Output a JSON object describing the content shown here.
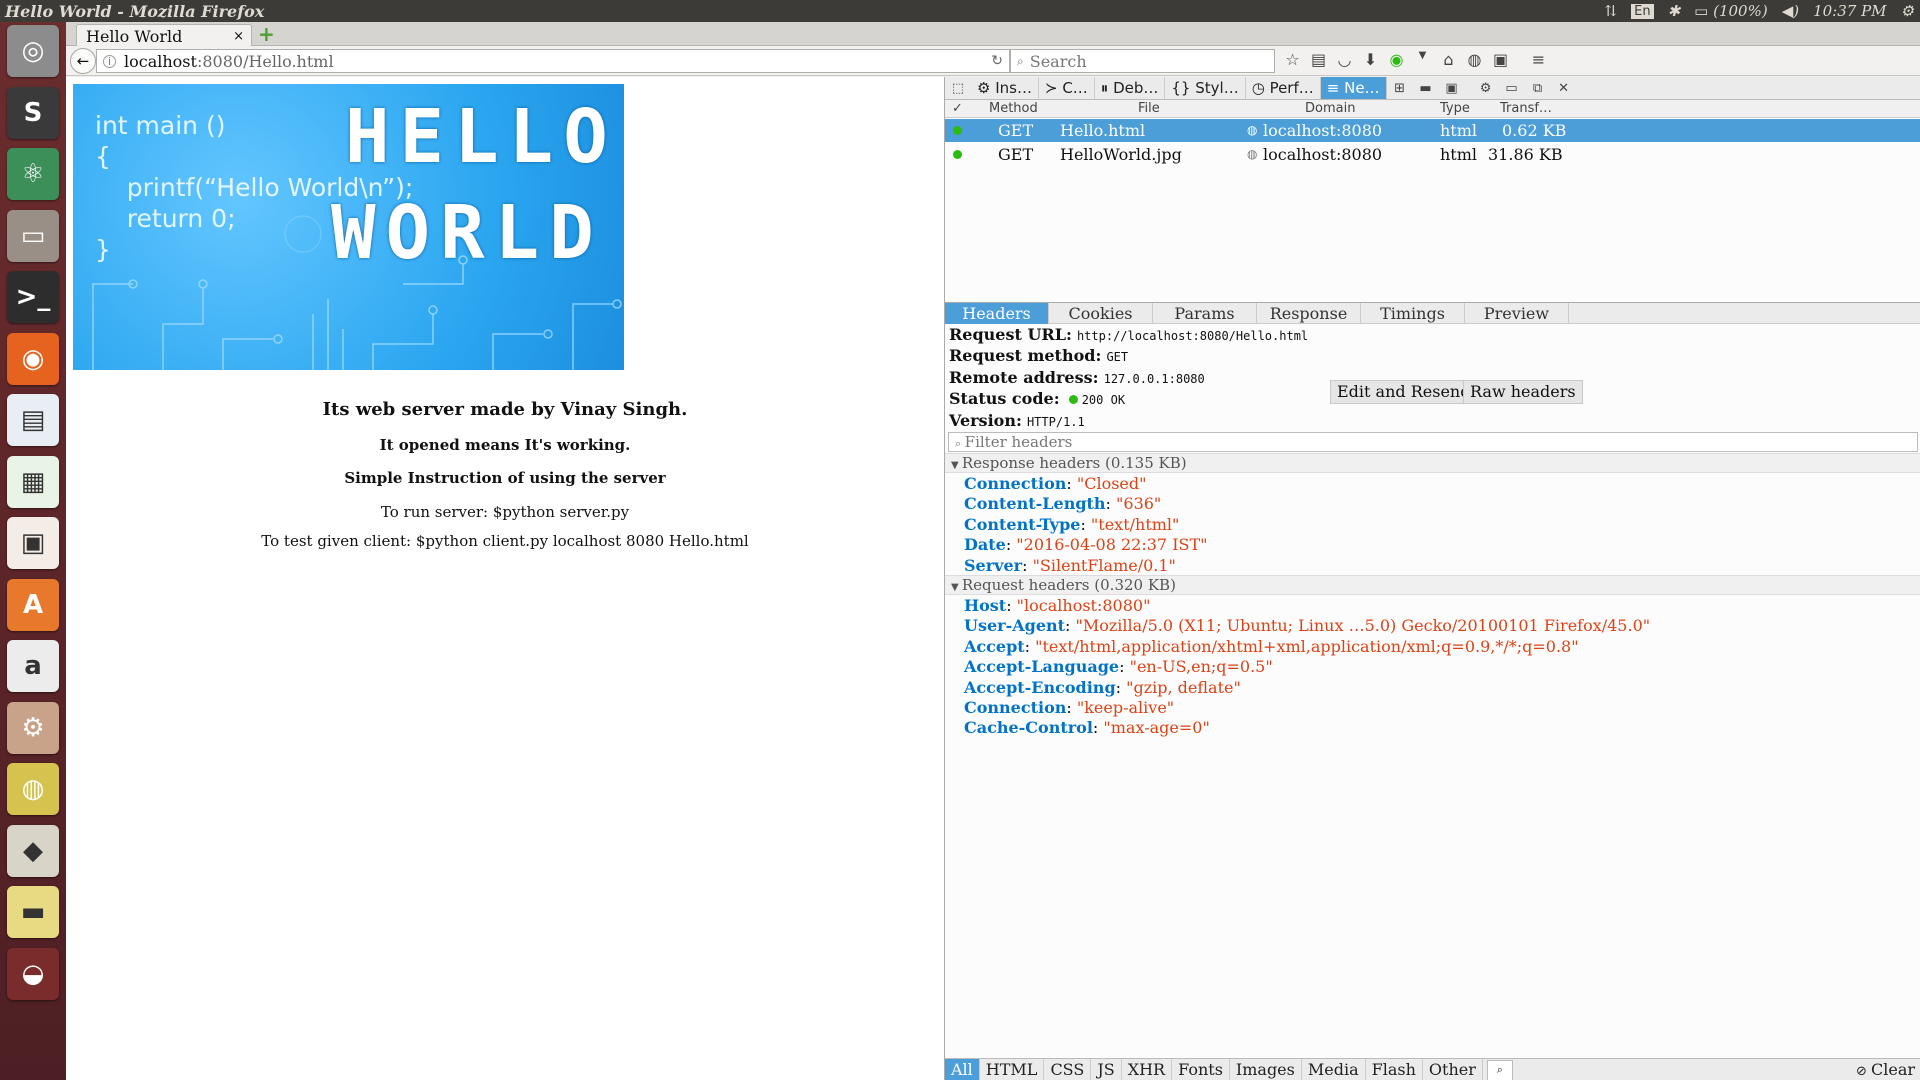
{
  "window": {
    "title": "Hello World - Mozilla Firefox",
    "tray": {
      "lang": "En",
      "battery": "(100%)",
      "time": "10:37 PM"
    }
  },
  "launcher": {
    "items": [
      {
        "name": "ubuntu-dash",
        "glyph": "◎",
        "color": "#8c8c8c"
      },
      {
        "name": "sublime-text",
        "glyph": "S",
        "color": "#3a3a3a"
      },
      {
        "name": "atom",
        "glyph": "⚛",
        "color": "#3d8f5a"
      },
      {
        "name": "files",
        "glyph": "▭",
        "color": "#9a8f86"
      },
      {
        "name": "terminal",
        "glyph": ">_",
        "color": "#2d2d2d"
      },
      {
        "name": "firefox",
        "glyph": "◉",
        "color": "#e6621f"
      },
      {
        "name": "libreoffice-draw",
        "glyph": "▤",
        "color": "#e9eef4"
      },
      {
        "name": "libreoffice-calc",
        "glyph": "▦",
        "color": "#e9f3e6"
      },
      {
        "name": "libreoffice-impress",
        "glyph": "▣",
        "color": "#f4ece6"
      },
      {
        "name": "software-center",
        "glyph": "A",
        "color": "#e8782c"
      },
      {
        "name": "amazon",
        "glyph": "a",
        "color": "#ececec"
      },
      {
        "name": "system-settings",
        "glyph": "⚙",
        "color": "#c9a28a"
      },
      {
        "name": "chrome",
        "glyph": "◍",
        "color": "#d6c24e"
      },
      {
        "name": "app-penguin",
        "glyph": "◆",
        "color": "#d8d4c8"
      },
      {
        "name": "app-sticky",
        "glyph": "▬",
        "color": "#e8da82"
      },
      {
        "name": "app-disk",
        "glyph": "◒",
        "color": "#7a2c2c"
      }
    ]
  },
  "browser": {
    "tab_title": "Hello World",
    "tab_close": "×",
    "new_tab": "+",
    "url_host": "localhost",
    "url_path": ":8080/Hello.html",
    "search_placeholder": "Search"
  },
  "page": {
    "banner_code": "int main ()\n{\n    printf(“Hello World\\n”);\n    return 0;\n}",
    "banner_hello": "HELLO",
    "banner_world": "WORLD",
    "heading": "Its web server made by Vinay Singh.",
    "subheading": "It opened means It's working.",
    "instruction_title": "Simple Instruction of using the server",
    "run_line": "To run server: $python server.py",
    "test_line": "To test given client: $python client.py localhost 8080 Hello.html"
  },
  "devtools": {
    "tabs": [
      "Ins…",
      "C…",
      "Deb…",
      "Styl…",
      "Perf…",
      "Ne…"
    ],
    "active_tab": 5,
    "columns": {
      "check": "✓",
      "method": "Method",
      "file": "File",
      "domain": "Domain",
      "type": "Type",
      "transferred": "Transf…"
    },
    "requests": [
      {
        "method": "GET",
        "file": "Hello.html",
        "domain": "localhost:8080",
        "type": "html",
        "size": "0.62 KB",
        "selected": true
      },
      {
        "method": "GET",
        "file": "HelloWorld.jpg",
        "domain": "localhost:8080",
        "type": "html",
        "size": "31.86 KB",
        "selected": false
      }
    ],
    "detail_tabs": [
      "Headers",
      "Cookies",
      "Params",
      "Response",
      "Timings",
      "Preview"
    ],
    "summary": {
      "url_label": "Request URL:",
      "url": "http://localhost:8080/Hello.html",
      "method_label": "Request method:",
      "method": "GET",
      "remote_label": "Remote address:",
      "remote": "127.0.0.1:8080",
      "status_label": "Status code:",
      "status": "200 OK",
      "version_label": "Version:",
      "version": "HTTP/1.1"
    },
    "edit_resend": "Edit and Resend",
    "raw_headers": "Raw headers",
    "filter_placeholder": "Filter headers",
    "response_group": "Response headers (0.135 KB)",
    "response_headers": [
      {
        "k": "Connection",
        "v": "\"Closed\""
      },
      {
        "k": "Content-Length",
        "v": "\"636\""
      },
      {
        "k": "Content-Type",
        "v": "\"text/html\""
      },
      {
        "k": "Date",
        "v": "\"2016-04-08 22:37 IST\""
      },
      {
        "k": "Server",
        "v": "\"SilentFlame/0.1\""
      }
    ],
    "request_group": "Request headers (0.320 KB)",
    "request_headers": [
      {
        "k": "Host",
        "v": "\"localhost:8080\""
      },
      {
        "k": "User-Agent",
        "v": "\"Mozilla/5.0 (X11; Ubuntu; Linux …5.0) Gecko/20100101 Firefox/45.0\""
      },
      {
        "k": "Accept",
        "v": "\"text/html,application/xhtml+xml,application/xml;q=0.9,*/*;q=0.8\""
      },
      {
        "k": "Accept-Language",
        "v": "\"en-US,en;q=0.5\""
      },
      {
        "k": "Accept-Encoding",
        "v": "\"gzip, deflate\""
      },
      {
        "k": "Connection",
        "v": "\"keep-alive\""
      },
      {
        "k": "Cache-Control",
        "v": "\"max-age=0\""
      }
    ],
    "footer_filters": [
      "All",
      "HTML",
      "CSS",
      "JS",
      "XHR",
      "Fonts",
      "Images",
      "Media",
      "Flash",
      "Other"
    ],
    "footer_clear": "Clear"
  }
}
